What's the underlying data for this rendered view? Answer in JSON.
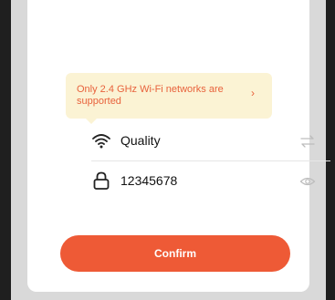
{
  "notice": {
    "text": "Only 2.4 GHz Wi-Fi networks are supported",
    "chevron": "›"
  },
  "wifi": {
    "icon": "wifi-icon",
    "network_name": "Quality",
    "switch_icon": "swap-icon"
  },
  "password": {
    "icon": "lock-icon",
    "value": "12345678",
    "visibility_icon": "eye-icon"
  },
  "confirm_label": "Confirm",
  "colors": {
    "accent": "#ee5a36",
    "notice_bg": "#fbf3d4",
    "notice_text": "#e8623c"
  }
}
